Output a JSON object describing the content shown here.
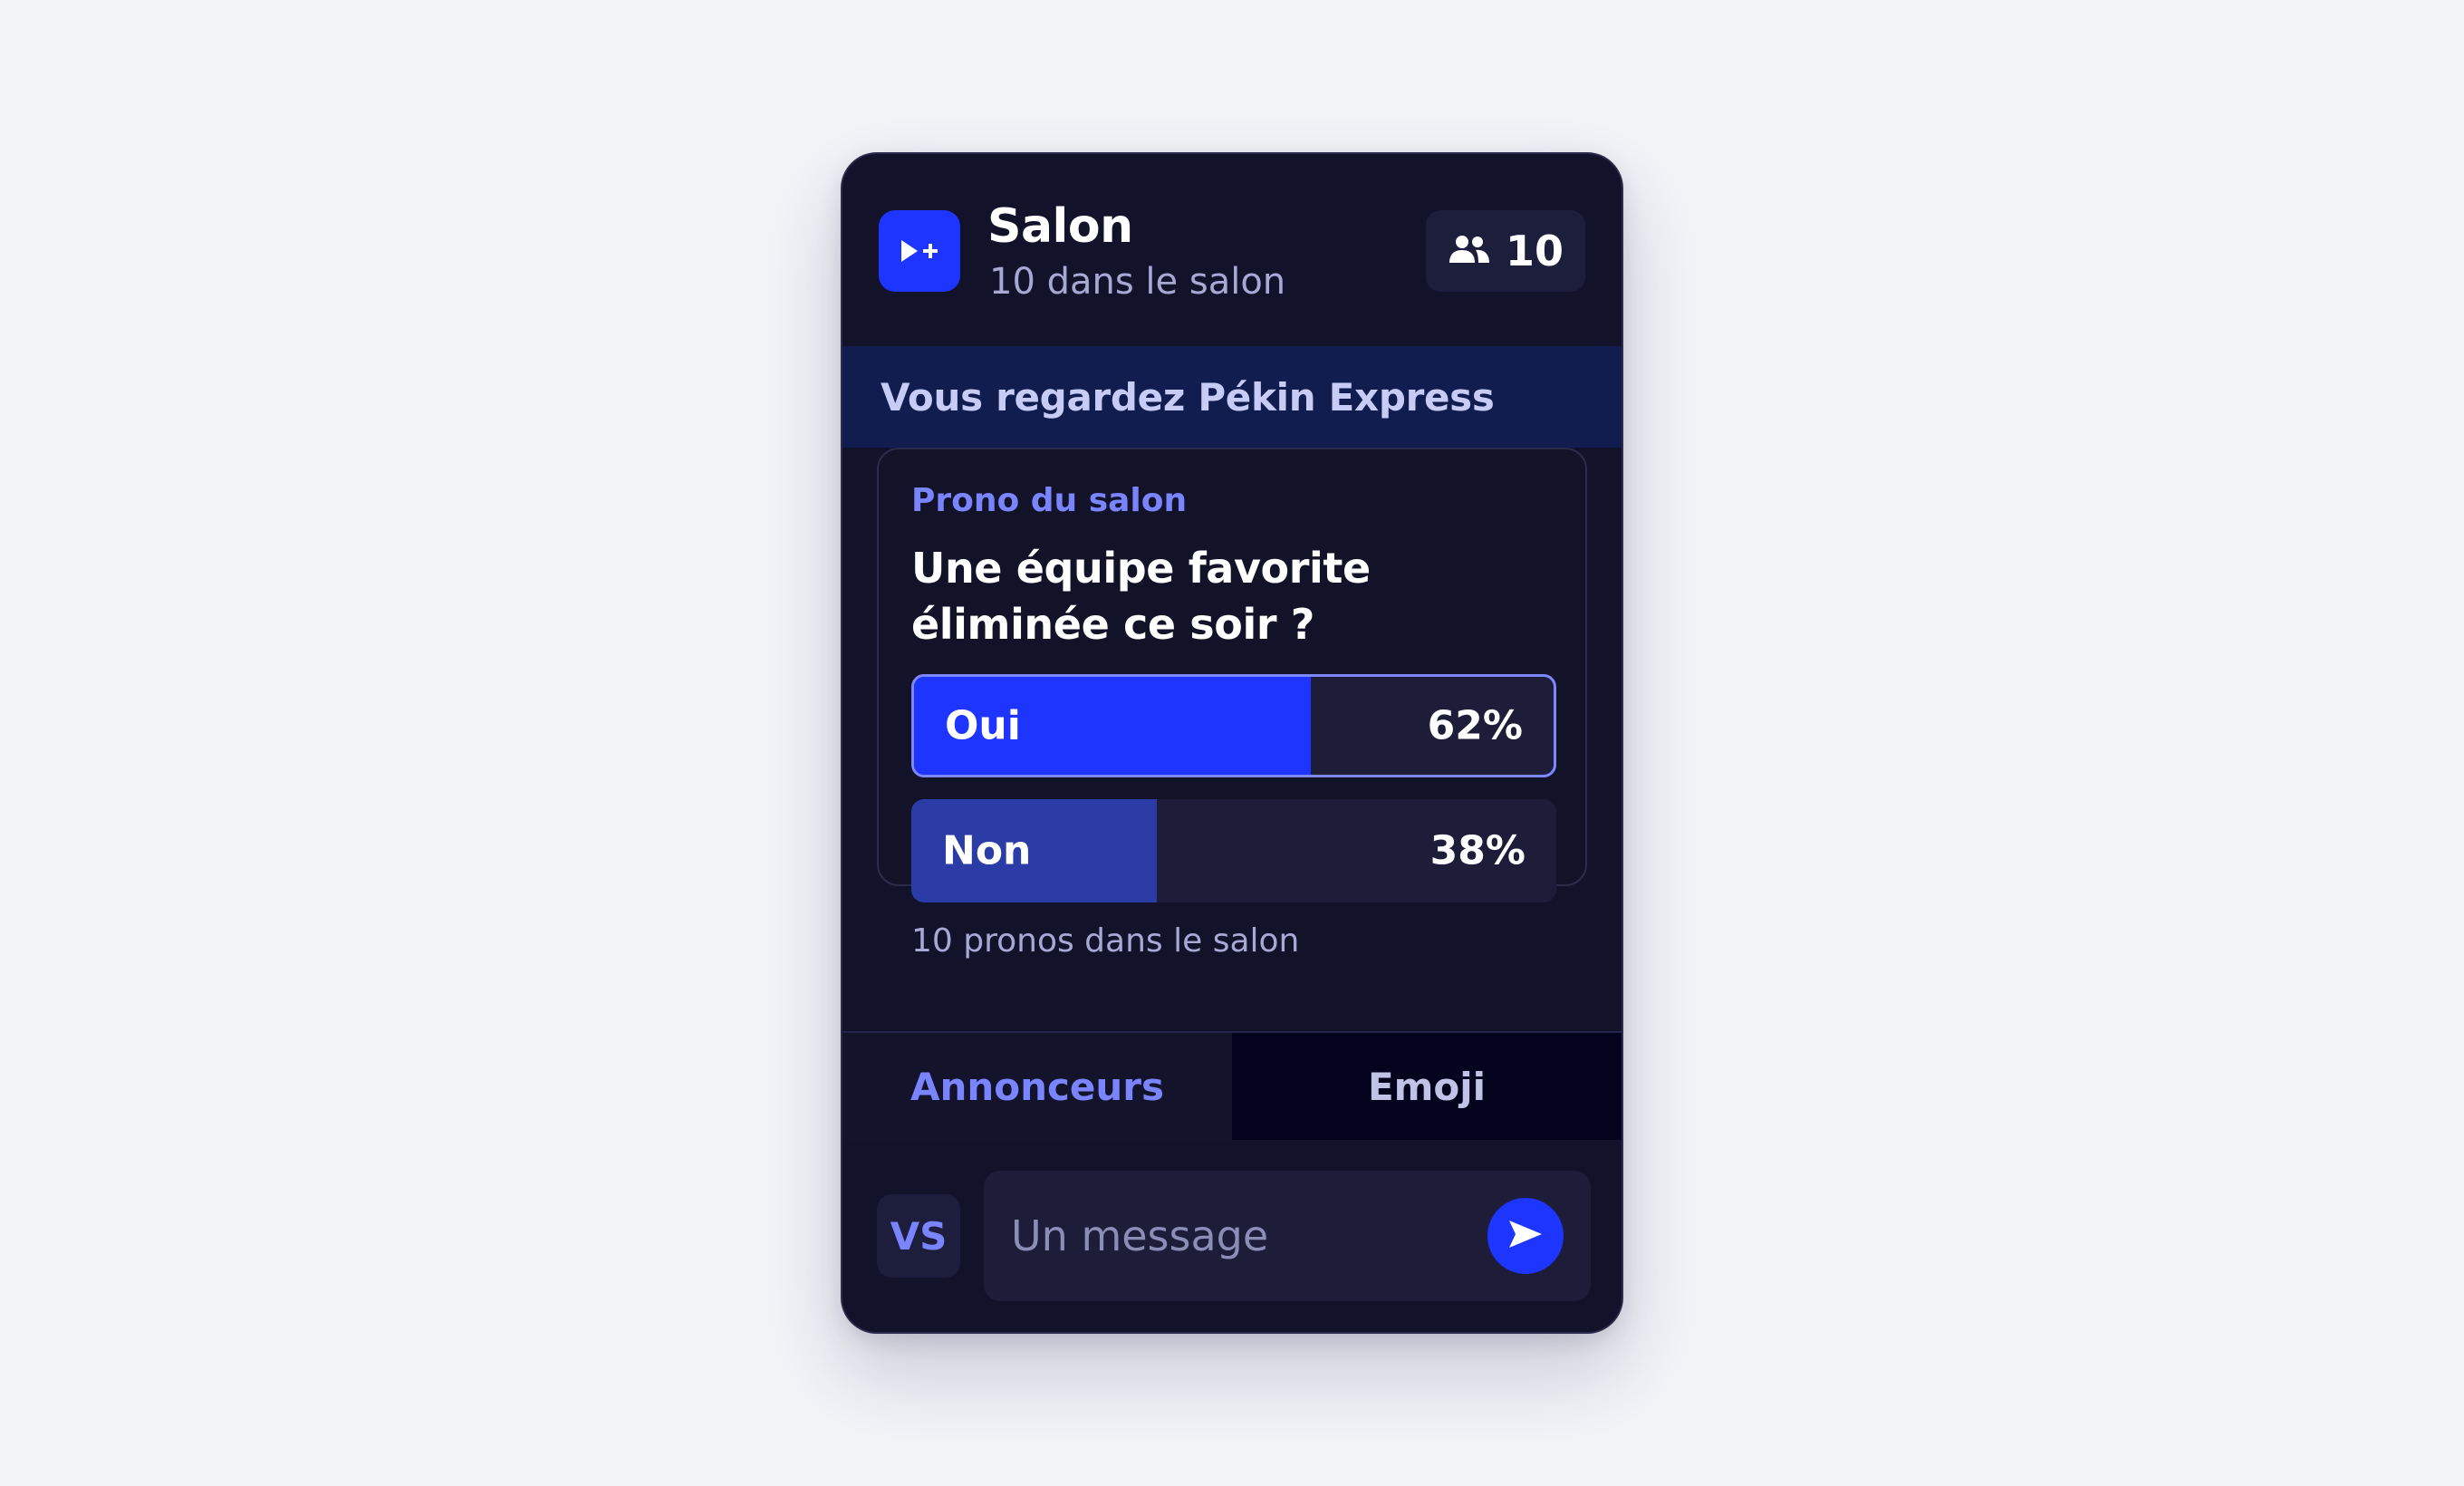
{
  "header": {
    "title": "Salon",
    "subtitle": "10 dans le salon",
    "member_count": "10",
    "app_icon": "play-plus-icon",
    "members_icon": "users-icon"
  },
  "banner": {
    "text": "Vous regardez Pékin Express"
  },
  "poll": {
    "kicker": "Prono du salon",
    "question": "Une équipe favorite éliminée ce soir ?",
    "options": [
      {
        "label": "Oui",
        "percent_label": "62%",
        "percent": 62,
        "selected": true,
        "color": "#1d35ff"
      },
      {
        "label": "Non",
        "percent_label": "38%",
        "percent": 38,
        "selected": false,
        "color": "#2b3ca6"
      }
    ],
    "footer": "10 pronos dans le salon"
  },
  "tabs": [
    {
      "label": "Annonceurs",
      "active": true
    },
    {
      "label": "Emoji",
      "active": false
    }
  ],
  "composer": {
    "avatar_initials": "VS",
    "placeholder": "Un message",
    "send_icon": "send-icon"
  },
  "colors": {
    "accent": "#1d35ff",
    "accent_light": "#7a84ff",
    "card_bg": "#12122a",
    "page_bg": "#f3f4f8"
  }
}
